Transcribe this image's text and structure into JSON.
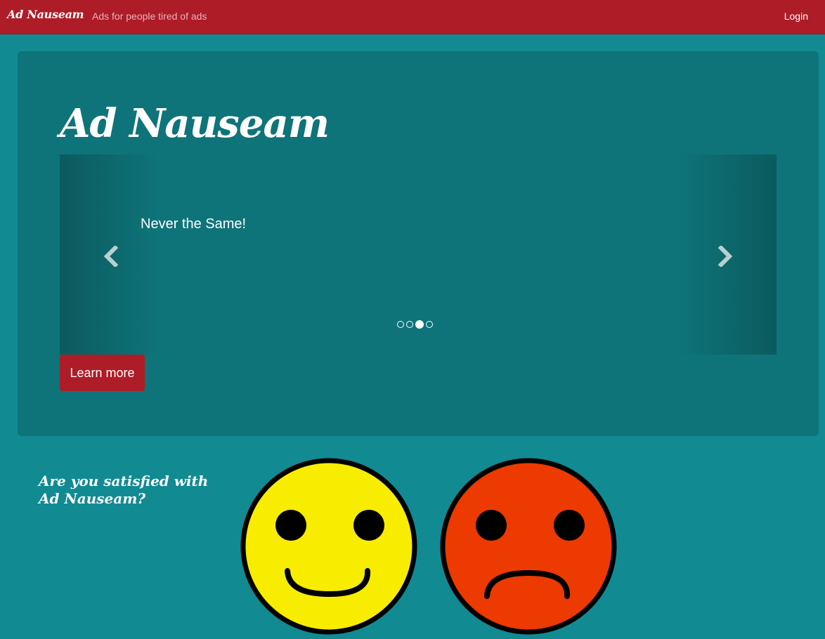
{
  "navbar": {
    "brand": "Ad Nauseam",
    "tagline": "Ads for people tired of ads",
    "login_label": "Login"
  },
  "hero": {
    "title": "Ad Nauseam",
    "carousel": {
      "caption": "Never the Same!",
      "slide_count": 4,
      "active_index": 2,
      "prev_icon": "chevron-left-icon",
      "next_icon": "chevron-right-icon"
    },
    "learn_more_label": "Learn more"
  },
  "feedback": {
    "question": "Are you satisfied with Ad Nauseam?",
    "options": [
      {
        "name": "happy-face",
        "color": "#f8ec00"
      },
      {
        "name": "sad-face",
        "color": "#ec3a00"
      }
    ]
  },
  "colors": {
    "navbar": "#ae1c28",
    "page_background": "#118a92",
    "jumbotron": "#0e7479",
    "button": "#ae1c28"
  }
}
